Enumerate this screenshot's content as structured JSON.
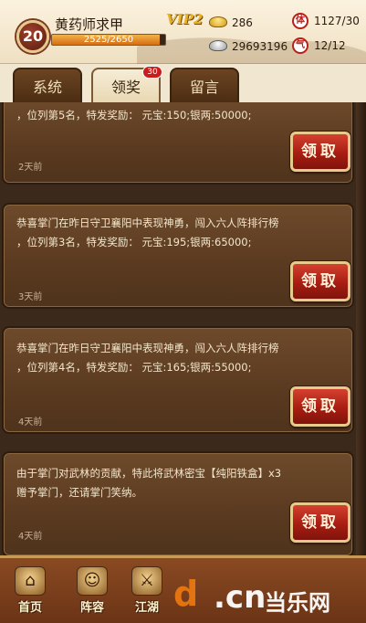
{
  "header": {
    "level": "20",
    "player_name": "黄药师求甲",
    "exp_text": "2525/2650",
    "exp_progress": 0.953,
    "vip_label": "VIP2",
    "gold": "286",
    "silver": "29693196",
    "stamina_icon_char": "体",
    "stamina": "1127/30",
    "energy_icon_char": "气",
    "energy": "12/12"
  },
  "tabs": [
    {
      "label": "系统"
    },
    {
      "label": "领奖",
      "badge": "30"
    },
    {
      "label": "留言"
    }
  ],
  "cards": [
    {
      "text": "，位列第5名，特发奖励： 元宝:150;银两:50000;",
      "time": "2天前",
      "button": "领取"
    },
    {
      "text": "恭喜掌门在昨日守卫襄阳中表现神勇，闯入六人阵排行榜\n，位列第3名，特发奖励： 元宝:195;银两:65000;",
      "time": "3天前",
      "button": "领取"
    },
    {
      "text": "恭喜掌门在昨日守卫襄阳中表现神勇，闯入六人阵排行榜\n，位列第4名，特发奖励： 元宝:165;银两:55000;",
      "time": "4天前",
      "button": "领取"
    },
    {
      "text": "由于掌门对武林的贡献，特此将武林密宝【纯阳铁盒】x3\n赠予掌门，还请掌门笑纳。",
      "time": "4天前",
      "button": "领取"
    }
  ],
  "bottom_nav": [
    {
      "label": "首页",
      "icon": "home-icon"
    },
    {
      "label": "阵容",
      "icon": "team-icon"
    },
    {
      "label": "江湖",
      "icon": "jianghu-icon"
    }
  ],
  "watermark": {
    "d": "d",
    "cn": ".cn",
    "site": "当乐网"
  }
}
